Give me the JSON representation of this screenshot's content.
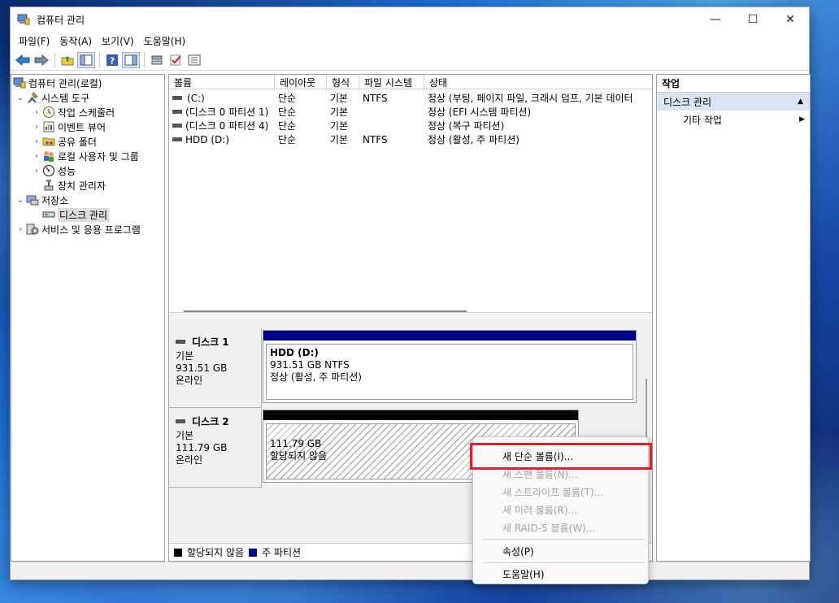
{
  "window": {
    "title": "컴퓨터 관리",
    "controls": {
      "minimize": "—",
      "maximize": "☐",
      "close": "✕"
    }
  },
  "menu": [
    "파일(F)",
    "동작(A)",
    "보기(V)",
    "도움말(H)"
  ],
  "toolbar": {
    "icons": [
      "back-arrow-icon",
      "forward-arrow-icon",
      "up-folder-icon",
      "show-hide-tree-icon",
      "help-icon",
      "show-hide-action-icon",
      "connect-icon",
      "check-icon",
      "properties-list-icon"
    ]
  },
  "tree": {
    "root": "컴퓨터 관리(로컬)",
    "system_tools": "시스템 도구",
    "task_scheduler": "작업 스케줄러",
    "event_viewer": "이벤트 뷰어",
    "shared_folders": "공유 폴더",
    "local_users": "로컬 사용자 및 그룹",
    "performance": "성능",
    "device_manager": "장치 관리자",
    "storage": "저장소",
    "disk_management": "디스크 관리",
    "services": "서비스 및 응용 프로그램"
  },
  "volume_list": {
    "columns": [
      "볼륨",
      "레이아웃",
      "형식",
      "파일 시스템",
      "상태"
    ],
    "rows": [
      {
        "volume": "(C:)",
        "layout": "단순",
        "type": "기본",
        "fs": "NTFS",
        "status": "정상 (부팅, 페이지 파일, 크래시 덤프, 기본 데이터"
      },
      {
        "volume": "(디스크 0 파티션 1)",
        "layout": "단순",
        "type": "기본",
        "fs": "",
        "status": "정상 (EFI 시스템 파티션)"
      },
      {
        "volume": "(디스크 0 파티션 4)",
        "layout": "단순",
        "type": "기본",
        "fs": "",
        "status": "정상 (복구 파티션)"
      },
      {
        "volume": "HDD (D:)",
        "layout": "단순",
        "type": "기본",
        "fs": "NTFS",
        "status": "정상 (활성, 주 파티션)"
      }
    ]
  },
  "disks": [
    {
      "name": "디스크 1",
      "kind": "기본",
      "size": "931.51 GB",
      "state": "온라인",
      "partition": {
        "label": "HDD  (D:)",
        "size": "931.51 GB NTFS",
        "status": "정상 (활성, 주 파티션)",
        "bar_color": "#00008b"
      }
    },
    {
      "name": "디스크 2",
      "kind": "기본",
      "size": "111.79 GB",
      "state": "온라인",
      "partition": {
        "size": "111.79 GB",
        "status": "할당되지 않음",
        "bar_color": "#000000"
      }
    }
  ],
  "legend": [
    {
      "label": "할당되지 않음",
      "color": "#000000"
    },
    {
      "label": "주 파티션",
      "color": "#00008b"
    }
  ],
  "actions": {
    "header": "작업",
    "section": "디스크 관리",
    "item": "기타 작업"
  },
  "context_menu": {
    "items": [
      {
        "label": "새 단순 볼륨(I)...",
        "enabled": true
      },
      {
        "label": "새 스팬 볼륨(N)...",
        "enabled": false
      },
      {
        "label": "새 스트라이프 볼륨(T)...",
        "enabled": false
      },
      {
        "label": "새 미러 볼륨(R)...",
        "enabled": false
      },
      {
        "label": "새 RAID-5 볼륨(W)...",
        "enabled": false
      },
      {
        "label": "속성(P)",
        "enabled": true
      },
      {
        "label": "도움말(H)",
        "enabled": true
      }
    ],
    "highlight_color": "#e0202a"
  }
}
